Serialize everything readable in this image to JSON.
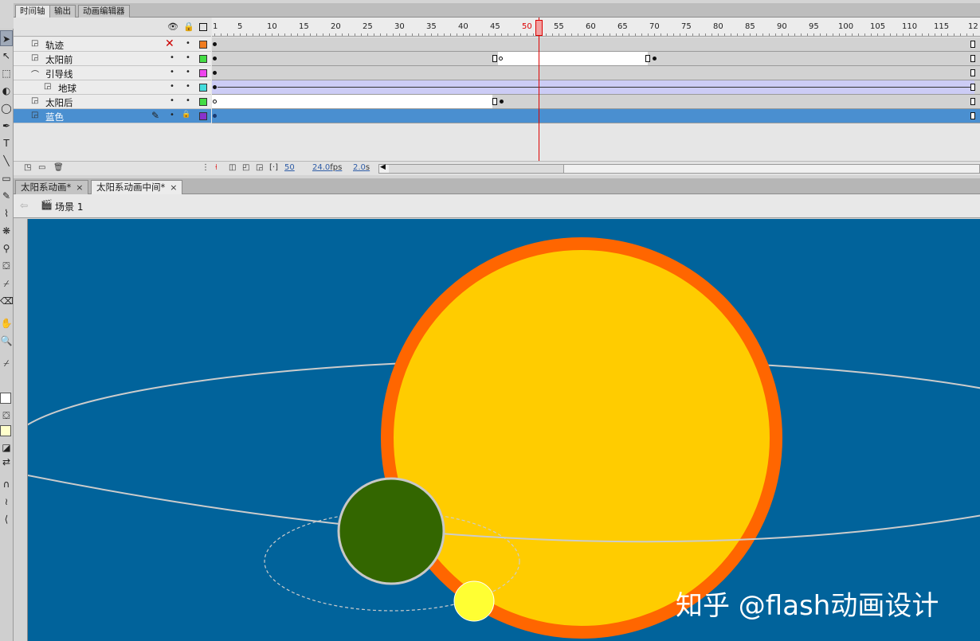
{
  "panel_tabs": [
    "时间轴",
    "输出",
    "动画编辑器"
  ],
  "ruler": {
    "first": "1",
    "marks": [
      "5",
      "10",
      "15",
      "20",
      "25",
      "30",
      "35",
      "40",
      "45",
      "50",
      "55",
      "60",
      "65",
      "70",
      "75",
      "80",
      "85",
      "90",
      "95",
      "100",
      "105",
      "110",
      "115",
      "12"
    ]
  },
  "current_frame": 50,
  "layers": [
    {
      "name": "轨迹",
      "color": "#f07c20",
      "hidden_x": "✕",
      "type": "normal"
    },
    {
      "name": "太阳前",
      "color": "#44dd44",
      "type": "normal"
    },
    {
      "name": "引导线",
      "color": "#ee44ee",
      "type": "guide"
    },
    {
      "name": "地球",
      "color": "#44dddd",
      "type": "guided"
    },
    {
      "name": "太阳后",
      "color": "#44dd44",
      "type": "normal"
    },
    {
      "name": "蓝色",
      "color": "#8833cc",
      "type": "normal",
      "selected": true
    }
  ],
  "footer": {
    "frame": "50",
    "fps": "24.0",
    "fps_unit": "fps",
    "time": "2.0",
    "time_unit": "s"
  },
  "doc_tabs": [
    {
      "label": "太阳系动画*",
      "close": "×",
      "active": false
    },
    {
      "label": "太阳系动画中间*",
      "close": "×",
      "active": true
    }
  ],
  "edit_bar": {
    "scene": "场景 1"
  },
  "stage": {
    "background": "#01639b",
    "sun_fill": "#ffcc00",
    "sun_stroke": "#ff6600",
    "earth_fill": "#336600",
    "moon_fill": "#ffff33",
    "orbit_color": "#cccccc"
  },
  "watermark": "知乎 @flash动画设计"
}
